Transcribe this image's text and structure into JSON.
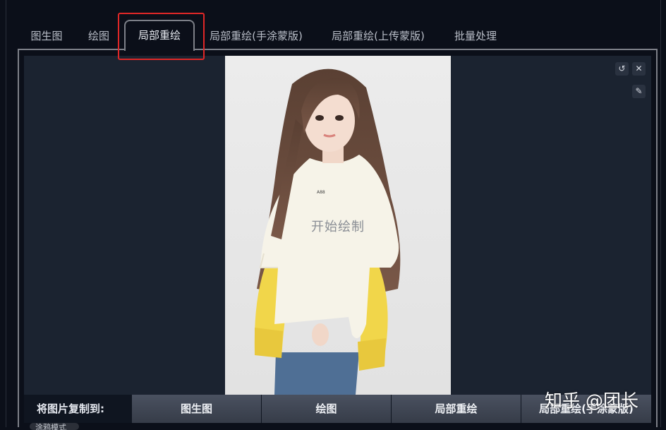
{
  "tabs": [
    {
      "label": "图生图"
    },
    {
      "label": "绘图"
    },
    {
      "label": "局部重绘",
      "active": true
    },
    {
      "label": "局部重绘(手涂蒙版)"
    },
    {
      "label": "局部重绘(上传蒙版)"
    },
    {
      "label": "批量处理"
    }
  ],
  "canvas": {
    "hint": "开始绘制",
    "icons": [
      "undo-icon",
      "close-icon",
      "brush-icon"
    ],
    "shirt_text": "A88"
  },
  "copy_bar": {
    "label": "将图片复制到:",
    "targets": [
      "图生图",
      "绘图",
      "局部重绘",
      "局部重绘(手涂蒙版)"
    ]
  },
  "bottom_pill": "涂鸦模式",
  "watermark": "知乎 @团长",
  "colors": {
    "highlight": "#e02727",
    "canvas_bg": "#1b2330",
    "page_bg": "#0b0f19"
  }
}
